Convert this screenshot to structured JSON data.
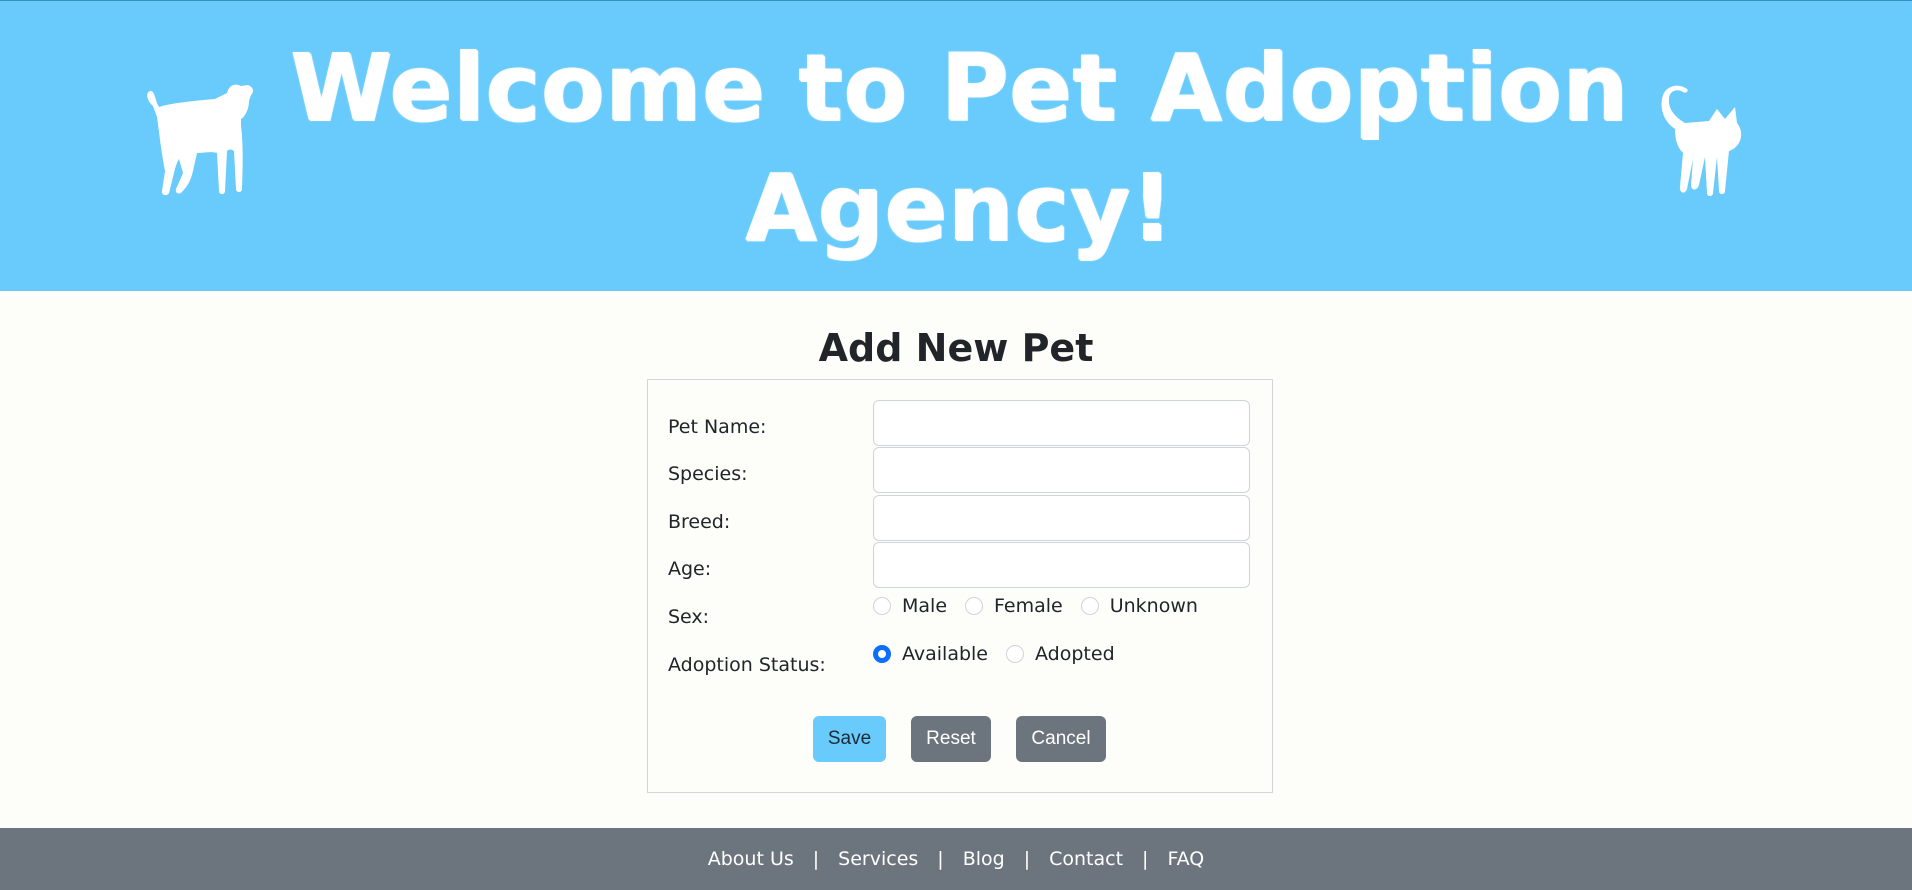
{
  "header": {
    "title": "Welcome to Pet Adoption Agency!",
    "left_icon": "dog-icon",
    "right_icon": "cat-icon",
    "background_color": "#69cbfb"
  },
  "form": {
    "heading": "Add New Pet",
    "fields": [
      {
        "label": "Pet Name:",
        "value": "",
        "placeholder": ""
      },
      {
        "label": "Species:",
        "value": "",
        "placeholder": ""
      },
      {
        "label": "Breed:",
        "value": "",
        "placeholder": ""
      },
      {
        "label": "Age:",
        "value": "",
        "placeholder": ""
      }
    ],
    "sex": {
      "label": "Sex:",
      "options": [
        "Male",
        "Female",
        "Unknown"
      ],
      "selected": null
    },
    "adoption_status": {
      "label": "Adoption Status:",
      "options": [
        "Available",
        "Adopted"
      ],
      "selected": "Available"
    },
    "buttons": {
      "save": "Save",
      "reset": "Reset",
      "cancel": "Cancel"
    }
  },
  "footer": {
    "links": [
      "About Us",
      "Services",
      "Blog",
      "Contact",
      "FAQ"
    ],
    "separator": "|"
  },
  "colors": {
    "accent": "#69cbfb",
    "radio_checked": "#0d6efd",
    "secondary_button": "#6c757d",
    "footer_background": "#6c757d",
    "page_background": "#fdfdf9"
  }
}
